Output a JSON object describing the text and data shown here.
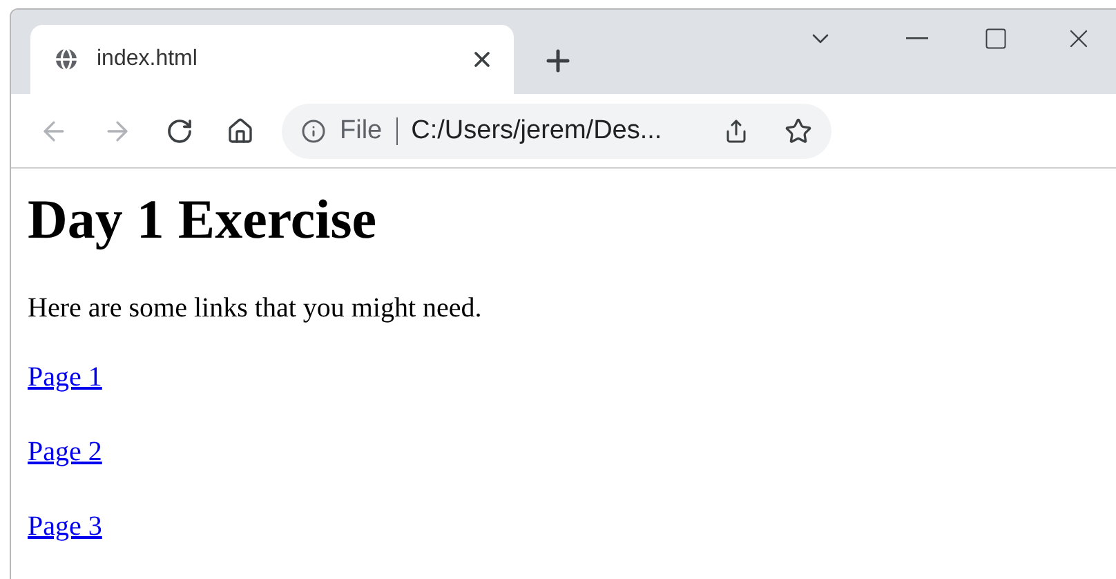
{
  "tab": {
    "title": "index.html",
    "selected": true
  },
  "nav": {
    "back_disabled": true,
    "forward_disabled": true
  },
  "address": {
    "scheme": "File",
    "url": "C:/Users/jerem/Des..."
  },
  "page": {
    "heading": "Day 1 Exercise",
    "paragraph": "Here are some links that you might need.",
    "links": [
      "Page 1",
      "Page 2",
      "Page 3"
    ]
  }
}
